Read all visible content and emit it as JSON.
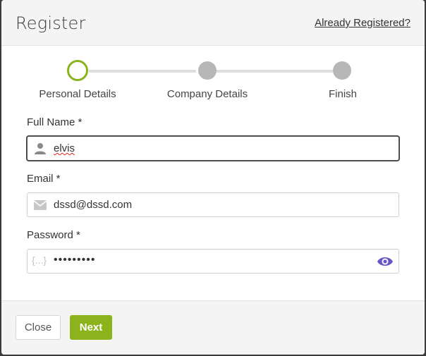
{
  "header": {
    "title": "Register",
    "already_registered_link": "Already Registered?"
  },
  "stepper": {
    "steps": [
      {
        "label": "Personal Details",
        "state": "active"
      },
      {
        "label": "Company Details",
        "state": "inactive"
      },
      {
        "label": "Finish",
        "state": "inactive"
      }
    ]
  },
  "form": {
    "full_name": {
      "label": "Full Name *",
      "value": "elvis",
      "icon": "person-icon"
    },
    "email": {
      "label": "Email *",
      "value": "dssd@dssd.com",
      "icon": "mail-icon"
    },
    "password": {
      "label": "Password *",
      "value": "•••••••••",
      "icon": "braces-icon",
      "toggle_icon": "eye-icon",
      "braces_text": "{...}"
    }
  },
  "footer": {
    "close_label": "Close",
    "next_label": "Next"
  },
  "colors": {
    "accent": "#8db31c",
    "eye": "#6a55c8"
  }
}
